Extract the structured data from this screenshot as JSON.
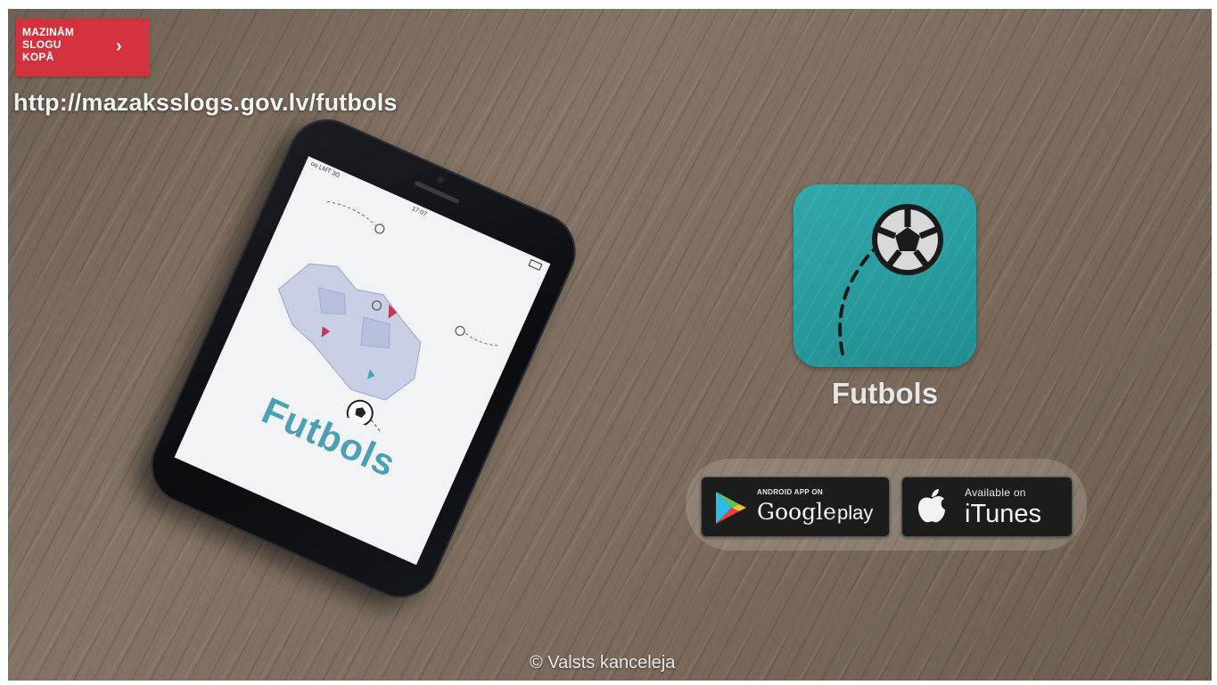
{
  "badge": {
    "line1": "MAZINĀM",
    "line2": "SLOGU",
    "line3": "KOPĀ",
    "arrow": "›",
    "icon": "chevron-right-icon"
  },
  "url": "http://mazaksslogs.gov.lv/futbols",
  "phone": {
    "carrier": "oo LMT  3G",
    "time": "17:07",
    "screen_title": "Futbols"
  },
  "app": {
    "name": "Futbols",
    "icon": "soccer-ball-icon",
    "icon_color": "#2aa1a3"
  },
  "stores": {
    "google": {
      "small": "ANDROID APP ON",
      "big_google": "Google",
      "big_play": "play",
      "icon": "google-play-icon"
    },
    "apple": {
      "small": "Available on",
      "big": "iTunes",
      "icon": "apple-icon"
    }
  },
  "footer": "© Valsts kanceleja",
  "colors": {
    "badge": "#d3313d",
    "screen_title": "#4da0b4"
  }
}
